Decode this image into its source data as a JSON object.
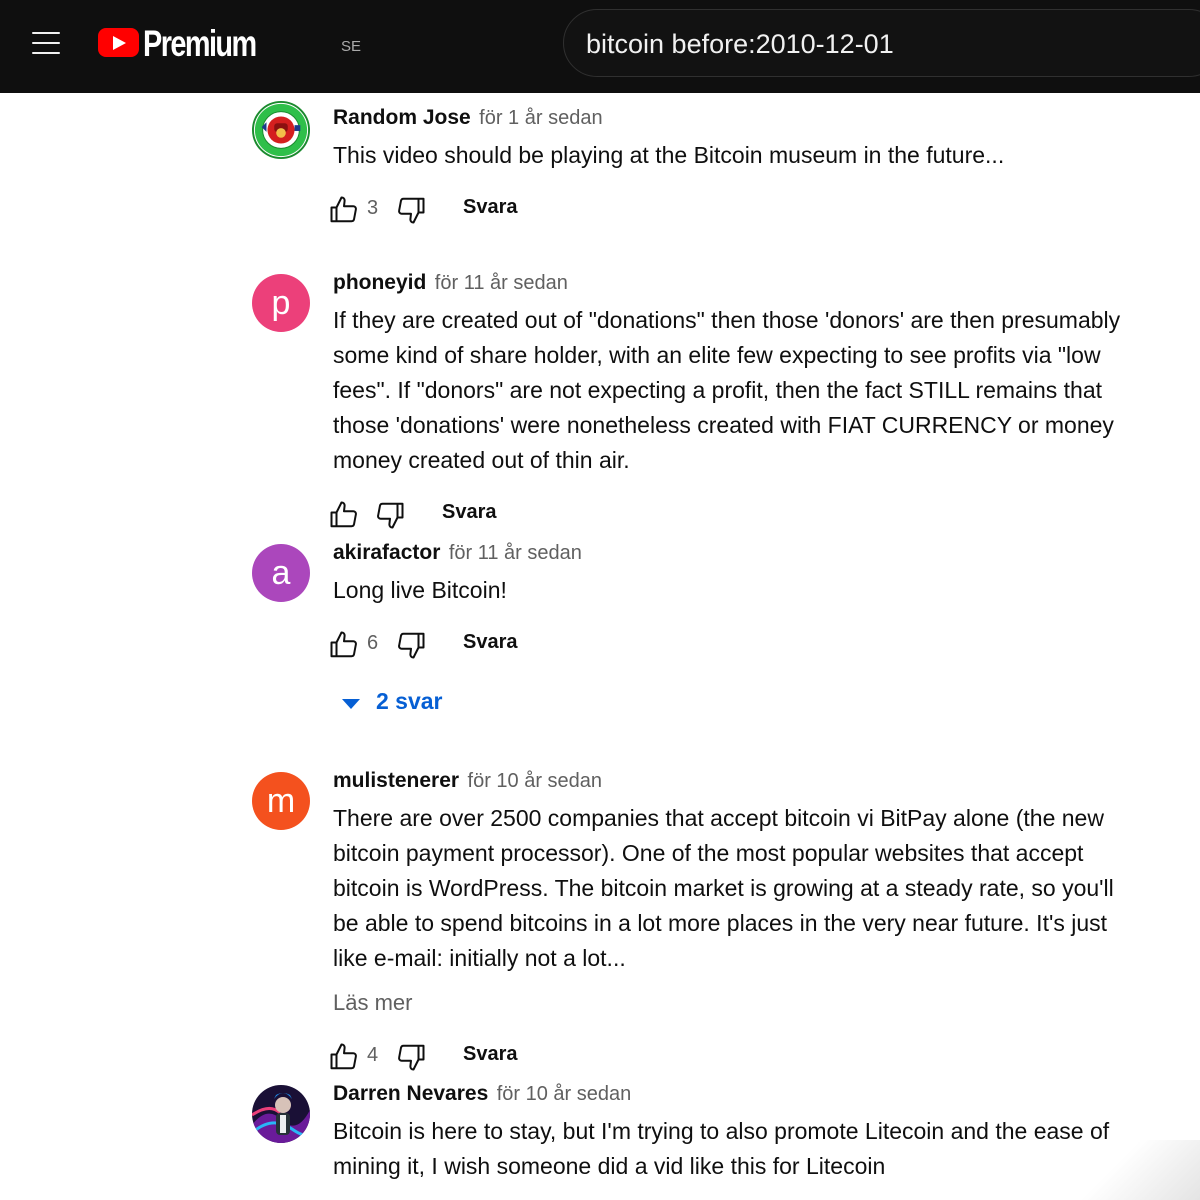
{
  "header": {
    "menu_icon": "hamburger-menu-icon",
    "logo_text": "Premium",
    "country_code": "SE",
    "search_value": "bitcoin before:2010-12-01"
  },
  "colors": {
    "header_bg": "#0f0f0f",
    "logo_red": "#ff0000",
    "link_blue": "#065fd4",
    "avatar_p": "#ec407a",
    "avatar_a": "#ab47bc",
    "avatar_m": "#f4511e"
  },
  "comments": [
    {
      "author": "Random Jose",
      "time": "för 1 år sedan",
      "text": "This video should be playing at the Bitcoin museum in the future...",
      "likes": "3",
      "reply_label": "Svara",
      "avatar_text": [
        "RANDOM",
        "JOSE"
      ]
    },
    {
      "author": "phoneyid",
      "time": "för 11 år sedan",
      "text": "If they are created out of \"donations\" then those 'donors' are then presumably some kind of share holder, with an elite few expecting to see profits via \"low fees\". If \"donors\" are not expecting a profit, then the fact STILL remains that those 'donations' were nonetheless created with FIAT CURRENCY or money money created out of thin air.",
      "likes": "",
      "reply_label": "Svara",
      "avatar_letter": "p"
    },
    {
      "author": "akirafactor",
      "time": "för 11 år sedan",
      "text": "Long live Bitcoin!",
      "likes": "6",
      "reply_label": "Svara",
      "avatar_letter": "a",
      "replies_label": "2 svar"
    },
    {
      "author": "mulistenerer",
      "time": "för 10 år sedan",
      "text": "There are over 2500 companies that accept bitcoin vi BitPay alone (the new bitcoin payment processor). One of the most popular websites that accept bitcoin is WordPress. The bitcoin market is growing at a steady rate, so you'll be able to spend bitcoins in a lot more places in the very near future. It's just like e-mail: initially not a lot...",
      "read_more": "Läs mer",
      "likes": "4",
      "reply_label": "Svara",
      "avatar_letter": "m"
    },
    {
      "author": "Darren Nevares",
      "time": "för 10 år sedan",
      "text": "Bitcoin is here to stay, but I'm trying to also promote Litecoin and the ease of mining it, I wish someone did a vid like this for Litecoin"
    }
  ]
}
